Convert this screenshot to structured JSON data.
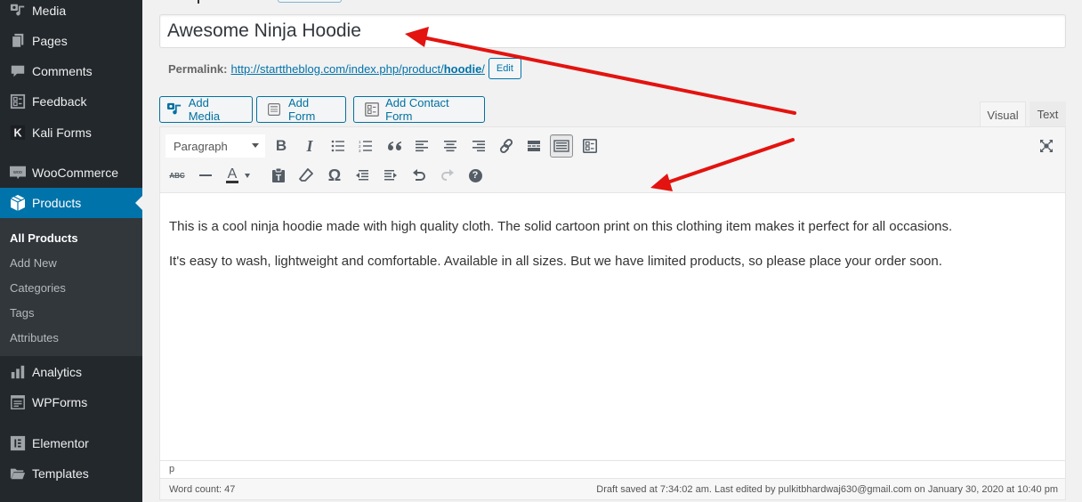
{
  "sidebar": {
    "items": [
      {
        "label": "Media",
        "icon": "media-icon"
      },
      {
        "label": "Pages",
        "icon": "pages-icon"
      },
      {
        "label": "Comments",
        "icon": "comment-icon"
      },
      {
        "label": "Feedback",
        "icon": "feedback-icon"
      },
      {
        "label": "Kali Forms",
        "icon": "kali-forms-icon"
      },
      {
        "label": "WooCommerce",
        "icon": "woocommerce-icon"
      },
      {
        "label": "Products",
        "icon": "products-box-icon",
        "active": true
      },
      {
        "label": "Analytics",
        "icon": "bar-chart-icon"
      },
      {
        "label": "WPForms",
        "icon": "wpforms-icon"
      },
      {
        "label": "Elementor",
        "icon": "elementor-icon"
      },
      {
        "label": "Templates",
        "icon": "folder-icon"
      }
    ],
    "submenu": [
      {
        "label": "All Products",
        "current": true
      },
      {
        "label": "Add New"
      },
      {
        "label": "Categories"
      },
      {
        "label": "Tags"
      },
      {
        "label": "Attributes"
      }
    ]
  },
  "post": {
    "title": "Awesome Ninja Hoodie",
    "permalink_label": "Permalink:",
    "permalink_base": "http://starttheblog.com/index.php/product/",
    "permalink_slug": "hoodie",
    "permalink_trail": "/",
    "edit_label": "Edit"
  },
  "media_buttons": {
    "add_media": "Add Media",
    "add_form": "Add Form",
    "add_contact_form": "Add Contact Form"
  },
  "editor_tabs": {
    "visual": "Visual",
    "text": "Text"
  },
  "toolbar": {
    "format_selected": "Paragraph",
    "text_color_letter": "A",
    "bold_letter": "B",
    "italic_letter": "I",
    "strike_letter": "ABC",
    "omega": "Ω",
    "help": "?"
  },
  "content": {
    "paragraphs": [
      "This is a cool ninja hoodie made with high quality cloth. The solid cartoon print on this clothing item makes it perfect for all occasions.",
      "It's easy to wash, lightweight and comfortable. Available in all sizes. But we have limited products, so please place your order soon."
    ]
  },
  "status": {
    "path": "p",
    "word_count": "Word count: 47",
    "last_edit": "Draft saved at 7:34:02 am. Last edited by pulkitbhardwaj630@gmail.com on January 30, 2020 at 10:40 pm"
  },
  "annotations": {
    "arrow_color": "#e3130f"
  }
}
